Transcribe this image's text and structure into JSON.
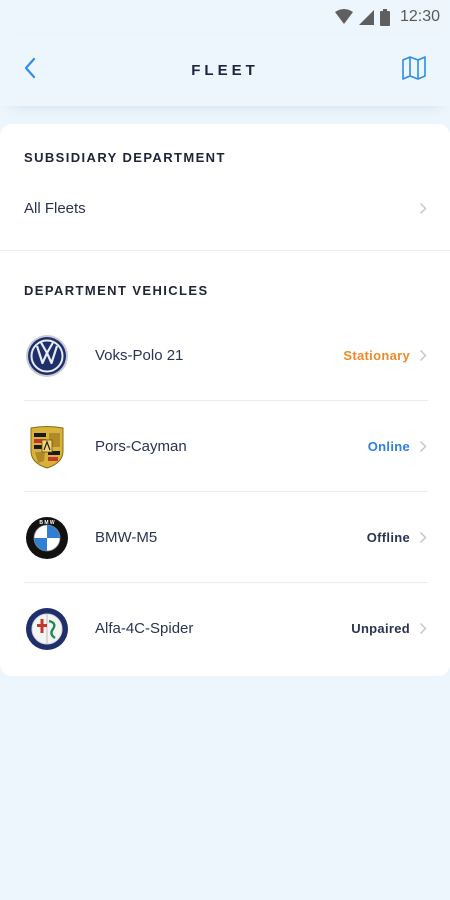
{
  "status_bar": {
    "time": "12:30"
  },
  "header": {
    "title": "FLEET",
    "back_icon": "chevron-left-icon",
    "map_icon": "map-icon"
  },
  "subsidiary": {
    "section_label": "SUBSIDIARY DEPARTMENT",
    "selected": "All Fleets"
  },
  "vehicles_section": {
    "section_label": "DEPARTMENT VEHICLES",
    "items": [
      {
        "name": "Voks-Polo 21",
        "status": "Stationary",
        "status_color": "#f08a24",
        "logo": "volkswagen-logo"
      },
      {
        "name": "Pors-Cayman",
        "status": "Online",
        "status_color": "#2e7fe0",
        "logo": "porsche-logo"
      },
      {
        "name": "BMW-M5",
        "status": "Offline",
        "status_color": "#2a3352",
        "logo": "bmw-logo"
      },
      {
        "name": "Alfa-4C-Spider",
        "status": "Unpaired",
        "status_color": "#2a3352",
        "logo": "alfa-romeo-logo"
      }
    ]
  },
  "colors": {
    "accent": "#2e8ee6",
    "background": "#edf6fc"
  }
}
